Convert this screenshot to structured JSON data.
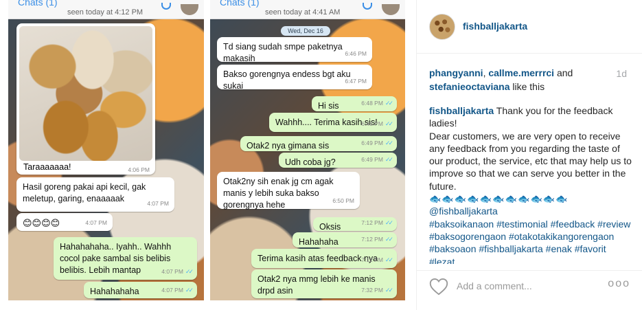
{
  "left_chat": {
    "header_back": "Chats (1)",
    "seen": "seen today at 4:12 PM",
    "photo_caption": "Taraaaaaaa!",
    "photo_time": "4:06 PM",
    "messages": [
      {
        "text": "Hasil goreng pakai api kecil, gak meletup, garing, enaaaaak",
        "time": "4:07 PM"
      },
      {
        "text": "😊😊😊😊",
        "time": "4:07 PM"
      },
      {
        "text": "Hahahahaha.. Iyahh.. Wahhh cocol pake sambal sis belibis belibis. Lebih mantap",
        "time": "4:07 PM"
      },
      {
        "text": "Hahahahaha",
        "time": "4:07 PM"
      }
    ]
  },
  "right_chat": {
    "header_back": "Chats (1)",
    "seen": "seen today at 4:41 AM",
    "date_chip": "Wed, Dec 16",
    "messages": [
      {
        "text": "Td siang sudah smpe paketnya makasih",
        "time": "6:46 PM"
      },
      {
        "text": "Bakso gorengnya endess bgt aku sukai",
        "time": "6:47 PM"
      },
      {
        "text": "Hi sis",
        "time": "6:48 PM"
      },
      {
        "text": "Wahhh.... Terima kasih sis!",
        "time": "6:48 PM"
      },
      {
        "text": "Otak2 nya gimana sis",
        "time": "6:49 PM"
      },
      {
        "text": "Udh coba jg?",
        "time": "6:49 PM"
      },
      {
        "text": "Otak2ny sih enak jg cm agak manis y lebih suka bakso gorengnya hehe",
        "time": "6:50 PM"
      },
      {
        "text": "Oksis",
        "time": "7:12 PM"
      },
      {
        "text": "Hahahaha",
        "time": "7:12 PM"
      },
      {
        "text": "Terima kasih atas feedback nya",
        "time": "7:12 PM"
      },
      {
        "text": "Otak2 nya mmg lebih ke manis drpd asin",
        "time": "7:32 PM"
      }
    ]
  },
  "post": {
    "username": "fishballjakarta",
    "likers": [
      "phangyanni",
      "callme.merrrci",
      "stefanieoctaviana"
    ],
    "likes_sep": ", ",
    "likes_and": " and ",
    "likes_suffix": " like this",
    "age": "1d",
    "caption_author": "fishballjakarta",
    "caption_line1": " Thank you for the feedback ladies!",
    "caption_line2": "Dear customers, we are very open to receive any feedback from you regarding the taste of our product, the service, etc that may help us to improve so that we can serve you better in the future.",
    "fish_emojis": "🐟🐟🐟🐟🐟🐟🐟🐟🐟🐟🐟",
    "mention": "@fishballjakarta",
    "hashtags": "#baksoikanaon #testimonial #feedback #review #baksogorengaon #otakotakikangorengaon #baksoaon #fishballjakarta #enak #favorit #lezat",
    "add_comment_placeholder": "Add a comment...",
    "more_label": "ooo"
  }
}
